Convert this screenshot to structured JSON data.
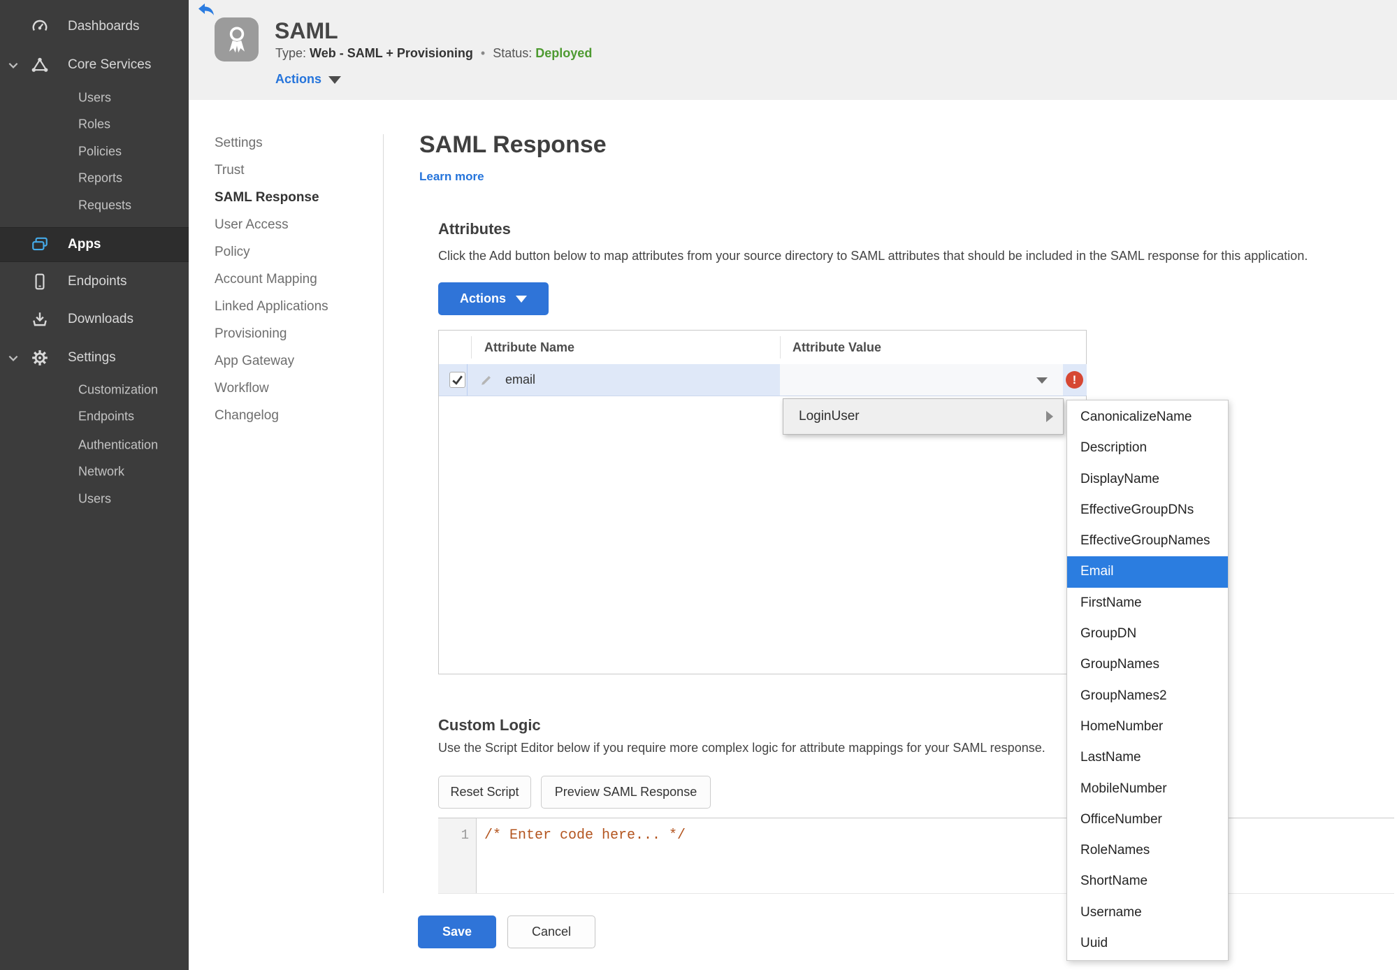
{
  "colors": {
    "accent_blue": "#2f74d8",
    "link_blue": "#2574db",
    "sidebar_icon_blue": "#45aae8",
    "status_green": "#4e9a31",
    "error_red": "#d64733",
    "menu_highlight_blue": "#2b7de0",
    "selected_row_blue": "#dfe8f8",
    "sidebar_bg": "#3c3c3c",
    "header_bg": "#f0f0f0",
    "code_comment_color": "#b3541e"
  },
  "sidebar": {
    "dashboards": "Dashboards",
    "core_services": "Core Services",
    "core_children": [
      "Users",
      "Roles",
      "Policies",
      "Reports",
      "Requests"
    ],
    "apps": "Apps",
    "endpoints": "Endpoints",
    "downloads": "Downloads",
    "settings": "Settings",
    "settings_children": [
      "Customization",
      "Endpoints",
      "Authentication",
      "Network",
      "Users"
    ]
  },
  "header": {
    "title": "SAML",
    "type_label": "Type:",
    "type_value": "Web - SAML + Provisioning",
    "dot": "•",
    "status_label": "Status:",
    "status_value": "Deployed",
    "actions_label": "Actions"
  },
  "subnav": {
    "items": [
      "Settings",
      "Trust",
      "SAML Response",
      "User Access",
      "Policy",
      "Account Mapping",
      "Linked Applications",
      "Provisioning",
      "App Gateway",
      "Workflow",
      "Changelog"
    ],
    "active": "SAML Response"
  },
  "page": {
    "title": "SAML Response",
    "learn_more": "Learn more"
  },
  "attributes": {
    "heading": "Attributes",
    "description": "Click the Add button below to map attributes from your source directory to SAML attributes that should be included in the SAML response for this application.",
    "actions_button": "Actions",
    "columns": [
      "Attribute Name",
      "Attribute Value"
    ],
    "rows": [
      {
        "name": "email",
        "value": "",
        "checked": true,
        "error": true
      }
    ]
  },
  "value_menu": {
    "root_item": "LoginUser",
    "items": [
      "CanonicalizeName",
      "Description",
      "DisplayName",
      "EffectiveGroupDNs",
      "EffectiveGroupNames",
      "Email",
      "FirstName",
      "GroupDN",
      "GroupNames",
      "GroupNames2",
      "HomeNumber",
      "LastName",
      "MobileNumber",
      "OfficeNumber",
      "RoleNames",
      "ShortName",
      "Username",
      "Uuid"
    ],
    "selected": "Email"
  },
  "custom_logic": {
    "heading": "Custom Logic",
    "description": "Use the Script Editor below if you require more complex logic for attribute mappings for your SAML response.",
    "reset_button": "Reset Script",
    "preview_button": "Preview SAML Response",
    "editor_line_number": "1",
    "editor_code": "/* Enter code here... */"
  },
  "footer": {
    "save_button": "Save",
    "cancel_button": "Cancel"
  },
  "icons": {
    "error_glyph": "!"
  }
}
